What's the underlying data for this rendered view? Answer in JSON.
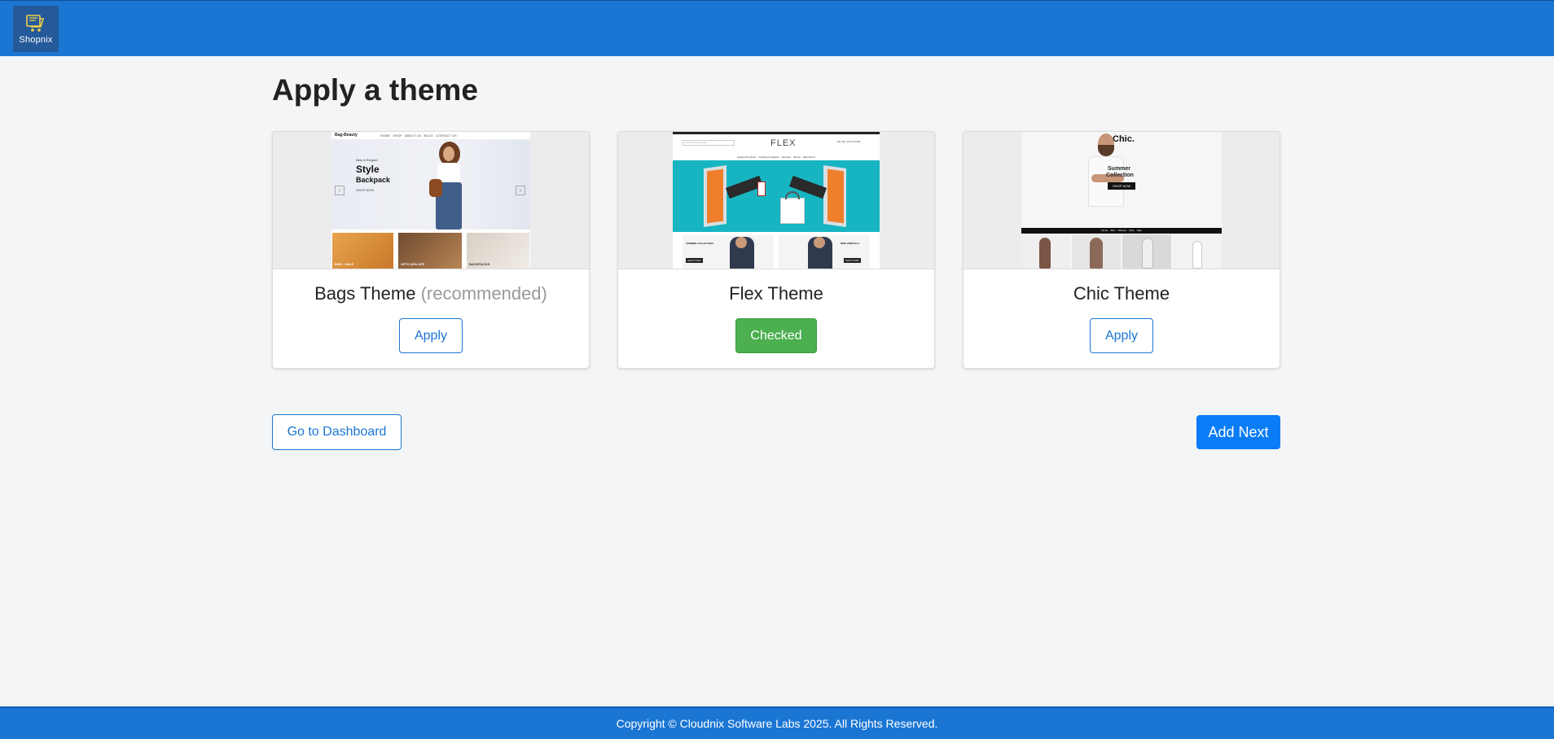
{
  "header": {
    "logo_text": "Shopnix"
  },
  "page": {
    "title": "Apply a theme"
  },
  "themes": [
    {
      "name": "Bags Theme",
      "tag": "(recommended)",
      "button_label": "Apply",
      "state": "apply",
      "preview": {
        "brand": "Bag-Beauty",
        "nav": [
          "HOME",
          "SHOP",
          "ABOUT US",
          "BLOG",
          "CONTACT US"
        ],
        "kicker": "New & Elegant",
        "headline_1": "Style",
        "headline_2": "Backpack",
        "cta": "SHOP NOW",
        "tiles": [
          "BAG - SALE",
          "UPTO 30% OFF",
          "BACKPACKS"
        ]
      }
    },
    {
      "name": "Flex Theme",
      "tag": "",
      "button_label": "Checked",
      "state": "checked",
      "preview": {
        "brand": "FLEX",
        "search_placeholder": "Search for products",
        "cart": "My Cart: Rs 0.00 INR",
        "nav": [
          "Apparel Products",
          "Clothing & Apparel",
          "Services",
          "Books",
          "Electronics"
        ],
        "tiles": [
          "SUMMER COLLECTION",
          "NEW ARRIVALS"
        ],
        "tile_cta": [
          "SHOP NOW",
          "SHOP NOW"
        ]
      }
    },
    {
      "name": "Chic Theme",
      "tag": "",
      "button_label": "Apply",
      "state": "apply",
      "preview": {
        "brand": "Chic.",
        "headline_1": "Summer",
        "headline_2": "Collection",
        "cta": "SHOP NOW",
        "nav": [
          "Home",
          "Men",
          "Women",
          "Kids",
          "Sale"
        ]
      }
    }
  ],
  "actions": {
    "dashboard_label": "Go to Dashboard",
    "next_label": "Add Next"
  },
  "footer": {
    "copyright": "Copyright © Cloudnix Software Labs 2025. All Rights Reserved."
  },
  "colors": {
    "primary": "#1b76d3",
    "next_button": "#0a7cf5",
    "checked": "#4caf50",
    "background": "#f3f5f7"
  }
}
